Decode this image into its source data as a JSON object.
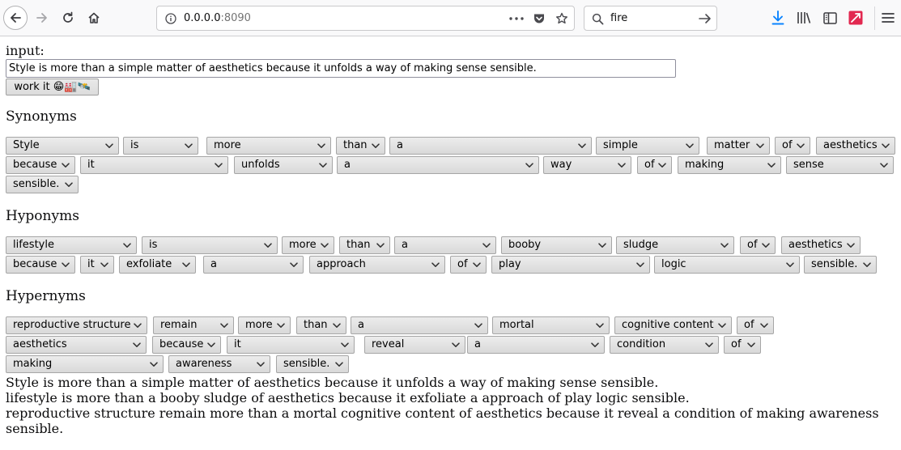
{
  "browser": {
    "url_host": "0.0.0.0",
    "url_port": ":8090",
    "search_value": "fire"
  },
  "form": {
    "input_label": "input:",
    "input_value": "Style is more than a simple matter of aesthetics because it unfolds a way of making sense sensible.",
    "button_label": "work it 😁🏭🛰️"
  },
  "sections": {
    "synonyms": {
      "title": "Synonyms",
      "rows": [
        [
          "Style",
          "is",
          "more",
          "than",
          "a",
          "simple",
          "matter",
          "of",
          "aesthetics"
        ],
        [
          "because",
          "it",
          "unfolds",
          "a",
          "way",
          "of",
          "making",
          "sense"
        ],
        [
          "sensible."
        ]
      ]
    },
    "hyponyms": {
      "title": "Hyponyms",
      "rows": [
        [
          "lifestyle",
          "is",
          "more",
          "than",
          "a",
          "booby",
          "sludge",
          "of",
          "aesthetics"
        ],
        [
          "because",
          "it",
          "exfoliate",
          "a",
          "approach",
          "of",
          "play",
          "logic",
          "sensible."
        ]
      ]
    },
    "hypernyms": {
      "title": "Hypernyms",
      "rows": [
        [
          "reproductive structure",
          "remain",
          "more",
          "than",
          "a",
          "mortal",
          "cognitive content",
          "of"
        ],
        [
          "aesthetics",
          "because",
          "it",
          "reveal",
          "a",
          "condition",
          "of"
        ],
        [
          "making",
          "awareness",
          "sensible."
        ]
      ]
    }
  },
  "results": [
    "Style is more than a simple matter of aesthetics because it unfolds a way of making sense sensible.",
    "lifestyle is more than a booby sludge of aesthetics because it exfoliate a approach of play logic sensible.",
    "reproductive structure remain more than a mortal cognitive content of aesthetics because it reveal a condition of making awareness",
    "sensible."
  ],
  "colors": {
    "download_accent": "#0a84ff",
    "addon_red": "#e22850"
  },
  "icons": [
    "back-arrow-icon",
    "forward-arrow-icon",
    "reload-icon",
    "home-icon",
    "info-icon",
    "more-dots-icon",
    "pocket-icon",
    "bookmark-star-icon",
    "search-icon",
    "go-arrow-icon",
    "download-icon",
    "library-icon",
    "sidebar-icon",
    "addon-icon",
    "menu-icon",
    "chevron-down-icon"
  ]
}
